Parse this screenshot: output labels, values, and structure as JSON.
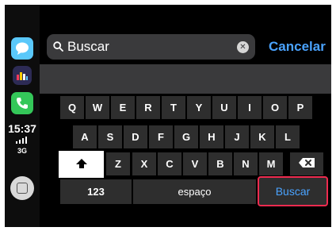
{
  "dock": {
    "apps": [
      {
        "name": "messages",
        "icon": "messages-icon"
      },
      {
        "name": "music",
        "icon": "music-app-icon"
      },
      {
        "name": "phone",
        "icon": "phone-icon"
      }
    ],
    "status": {
      "time": "15:37",
      "network": "3G"
    },
    "home_icon": "home-button-icon"
  },
  "search": {
    "placeholder": "Buscar",
    "value": "",
    "cancel_label": "Cancelar"
  },
  "keyboard": {
    "row1": [
      "Q",
      "W",
      "E",
      "R",
      "T",
      "Y",
      "U",
      "I",
      "O",
      "P"
    ],
    "row2": [
      "A",
      "S",
      "D",
      "F",
      "G",
      "H",
      "J",
      "K",
      "L"
    ],
    "row3": [
      "Z",
      "X",
      "C",
      "V",
      "B",
      "N",
      "M"
    ],
    "numbers_label": "123",
    "space_label": "espaço",
    "return_label": "Buscar"
  },
  "colors": {
    "accent": "#4aa3ff",
    "highlight": "#ee2b4f",
    "key": "#2e2e2e"
  }
}
